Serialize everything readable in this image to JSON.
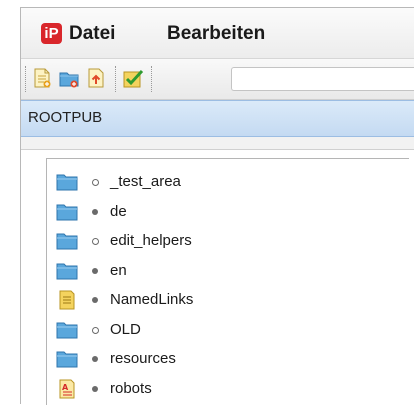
{
  "menu": {
    "logo_text": "iP",
    "items": [
      {
        "label": "Datei"
      },
      {
        "label": "Bearbeiten"
      }
    ]
  },
  "toolbar": {
    "buttons": [
      {
        "icon": "new-document-icon"
      },
      {
        "icon": "new-folder-icon"
      },
      {
        "icon": "upload-file-icon"
      },
      {
        "icon": "approve-checkmark-icon"
      }
    ],
    "input_value": ""
  },
  "path": {
    "current": "ROOTPUB"
  },
  "tree": {
    "items": [
      {
        "label": "_test_area",
        "icon": "folder-icon",
        "status": "hollow"
      },
      {
        "label": "de",
        "icon": "folder-icon",
        "status": "filled"
      },
      {
        "label": "edit_helpers",
        "icon": "folder-icon",
        "status": "hollow"
      },
      {
        "label": "en",
        "icon": "folder-icon",
        "status": "filled"
      },
      {
        "label": "NamedLinks",
        "icon": "document-icon",
        "status": "filled"
      },
      {
        "label": "OLD",
        "icon": "folder-icon",
        "status": "hollow"
      },
      {
        "label": "resources",
        "icon": "folder-icon",
        "status": "filled"
      },
      {
        "label": "robots",
        "icon": "text-file-icon",
        "status": "filled"
      }
    ]
  },
  "colors": {
    "logo": "#d9262b",
    "path_bar": "#c4daf2",
    "folder": "#5aa7dc",
    "document": "#f2c12e"
  }
}
